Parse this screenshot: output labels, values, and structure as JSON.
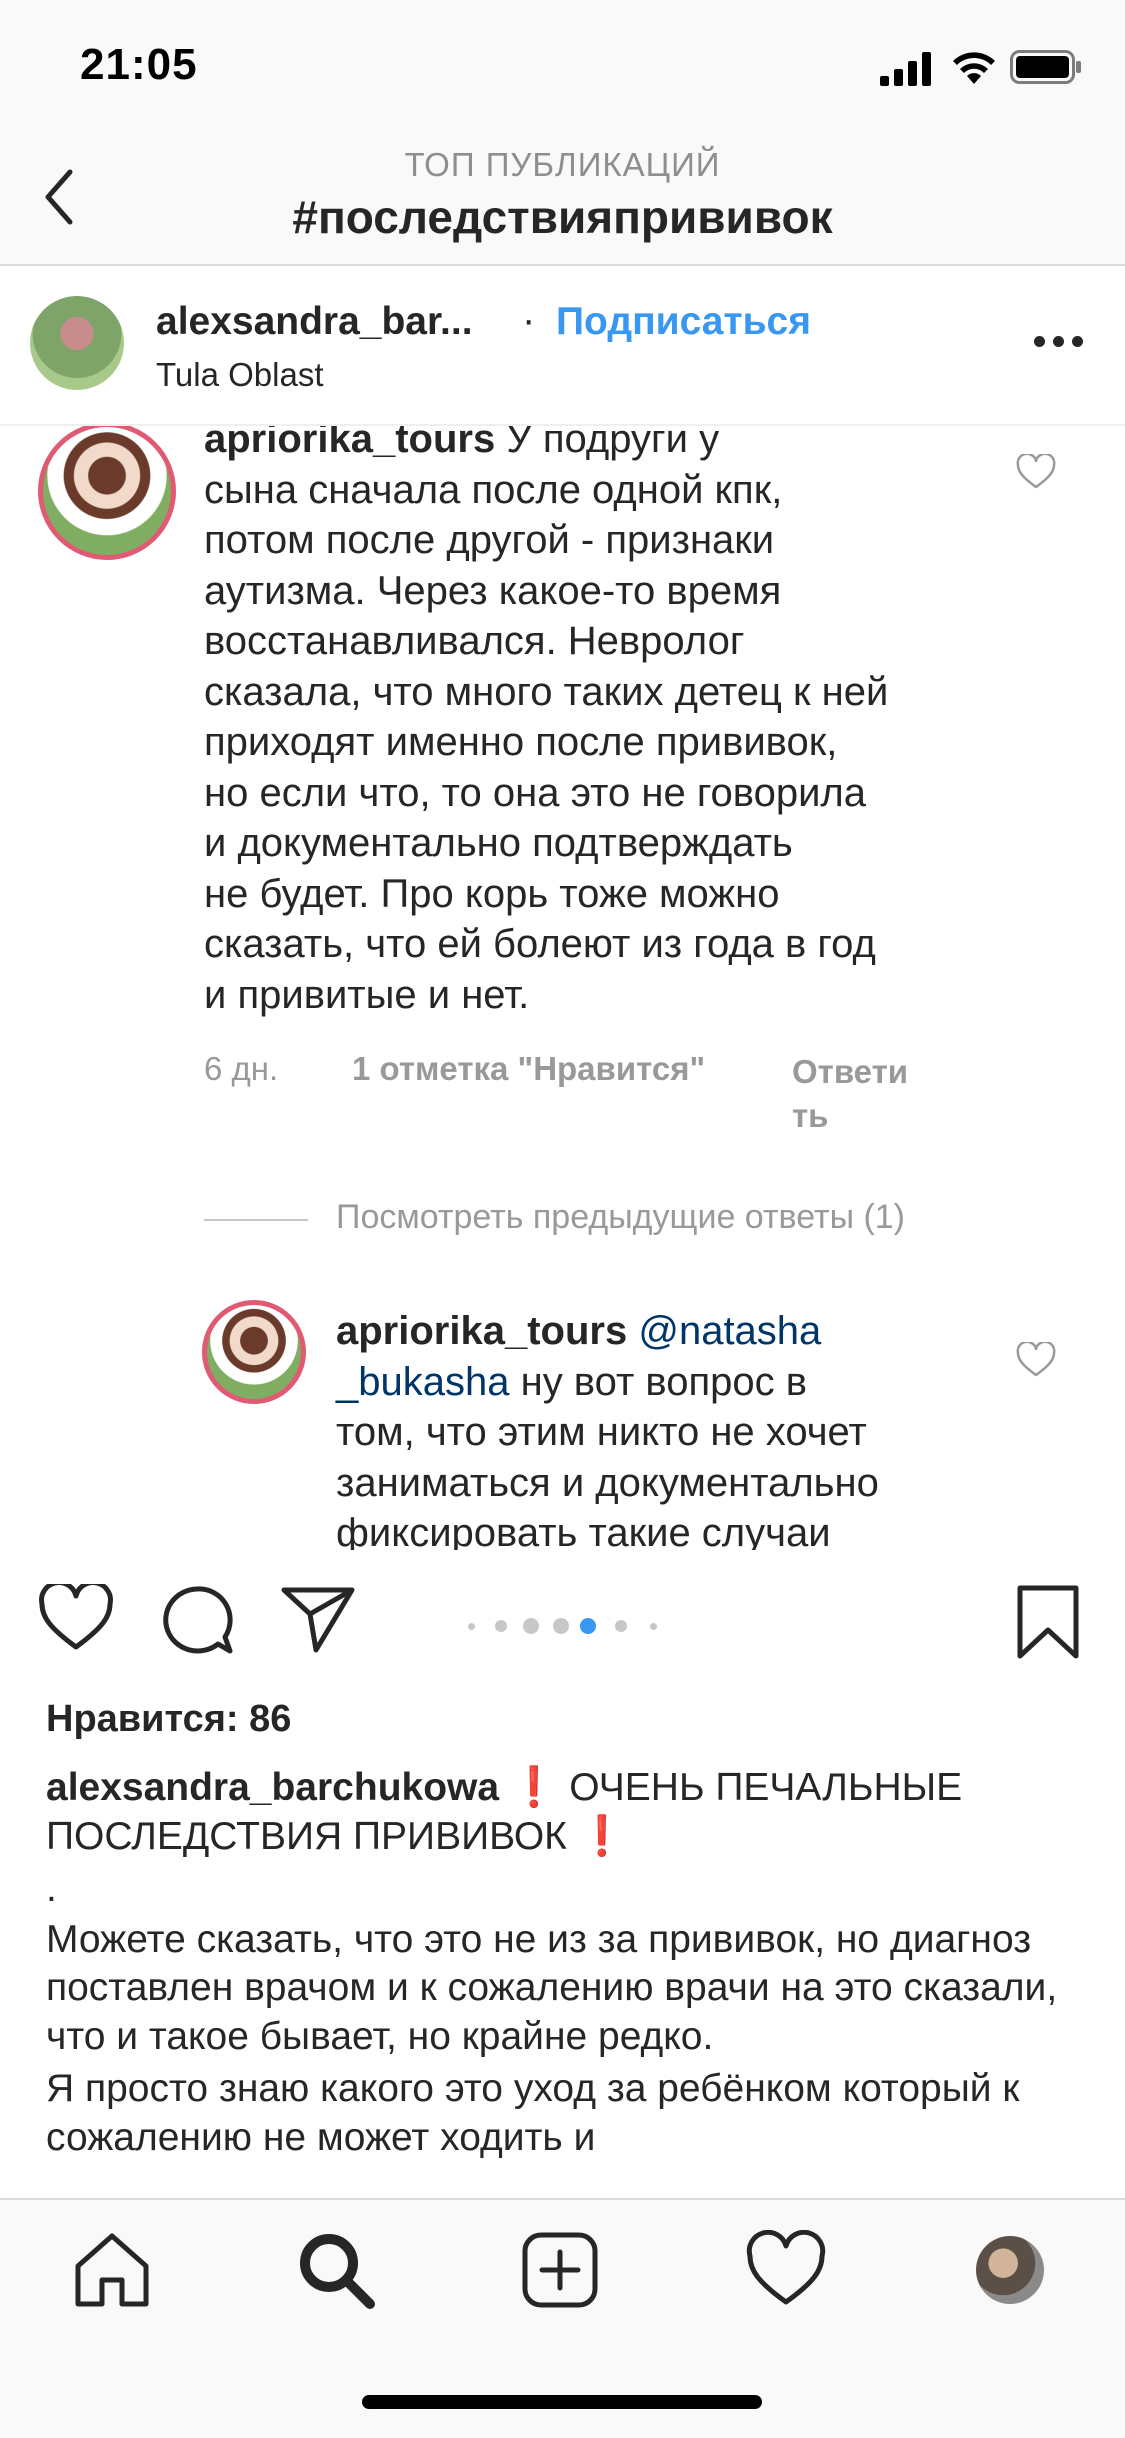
{
  "status_bar": {
    "time": "21:05"
  },
  "header": {
    "subtitle": "ТОП ПУБЛИКАЦИЙ",
    "title": "#последствияпрививок"
  },
  "post": {
    "username": "alexsandra_bar...",
    "separator": "·",
    "follow_label": "Подписаться",
    "location": "Tula Oblast"
  },
  "image_comments": {
    "comment1": {
      "user": "apriorika_tours",
      "lines": [
        "У подруги у",
        "сына сначала после одной кпк,",
        "потом после другой - признаки",
        "аутизма. Через какое-то время",
        "восстанавливался. Невролог",
        "сказала, что много таких детец к ней",
        "приходят именно после прививок,",
        "но если что, то она это не говорила",
        "и документально подтверждать",
        "не будет. Про корь тоже можно",
        "сказать, что ей болеют из года в год",
        "и привитые и нет."
      ],
      "age": "6 дн.",
      "likes": "1 отметка \"Нравится\"",
      "reply_line1": "Ответи",
      "reply_line2": "ть"
    },
    "view_previous": "Посмотреть предыдущие ответы (1)",
    "comment2": {
      "user": "apriorika_tours",
      "mention_line1": "@natasha",
      "mention_line2": "_bukasha",
      "line2_rest": " ну вот вопрос в",
      "lines": [
        "том, что этим никто не хочет",
        "заниматься и документально",
        "фиксировать такие случаи"
      ]
    }
  },
  "carousel": {
    "count": 6,
    "active_index": 3,
    "active_color": "#3897f0"
  },
  "likes_label": "Нравится: 86",
  "caption": {
    "username": "alexsandra_barchukowa",
    "excl": "❗",
    "line1_text": " ОЧЕНЬ ПЕЧАЛЬНЫЕ",
    "line2_text": "ПОСЛЕДСТВИЯ ПРИВИВОК ",
    "dot": ".",
    "paragraph1": "Можете сказать, что это не из за прививок, но диагноз поставлен врачом и к сожалению врачи на это сказали, что и такое бывает, но крайне редко.",
    "paragraph2": "Я просто знаю какого это уход за ребёнком который к сожалению не может ходить и"
  },
  "tabs": [
    "home-icon",
    "search-icon",
    "add-post-icon",
    "activity-heart-icon",
    "profile-avatar"
  ],
  "colors": {
    "link_blue": "#3897f0",
    "mention_blue": "#003569",
    "story_ring": "#e05a74",
    "alert_red": "#ed2a3a"
  }
}
